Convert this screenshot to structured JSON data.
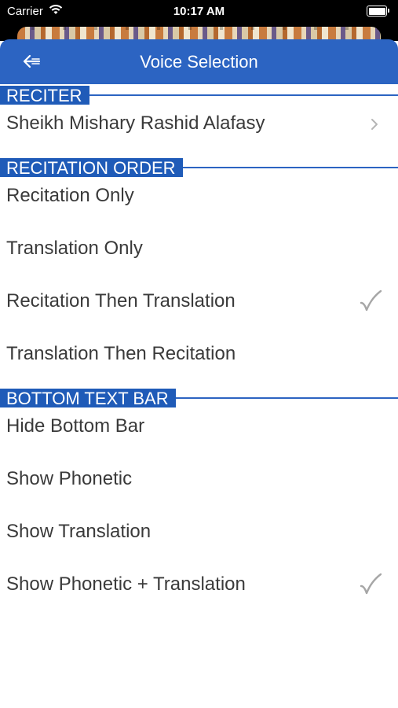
{
  "status_bar": {
    "carrier": "Carrier",
    "time": "10:17 AM"
  },
  "nav": {
    "title": "Voice Selection",
    "back_icon": "back-arrow-icon"
  },
  "sections": {
    "reciter": {
      "header": "RECITER",
      "selected_reciter": "Sheikh Mishary Rashid Alafasy"
    },
    "recitation_order": {
      "header": "RECITATION ORDER",
      "options": [
        "Recitation Only",
        "Translation Only",
        "Recitation Then Translation",
        "Translation Then Recitation"
      ],
      "selected": "Recitation Then Translation"
    },
    "bottom_text_bar": {
      "header": "BOTTOM TEXT BAR",
      "options": [
        "Hide Bottom Bar",
        "Show Phonetic",
        "Show Translation",
        "Show Phonetic + Translation"
      ],
      "selected": "Show Phonetic + Translation"
    }
  },
  "colors": {
    "nav_bar": "#2c64c2",
    "section_header": "#1f5bb8",
    "text": "#3a3a3a",
    "check": "#a6a6a6"
  }
}
